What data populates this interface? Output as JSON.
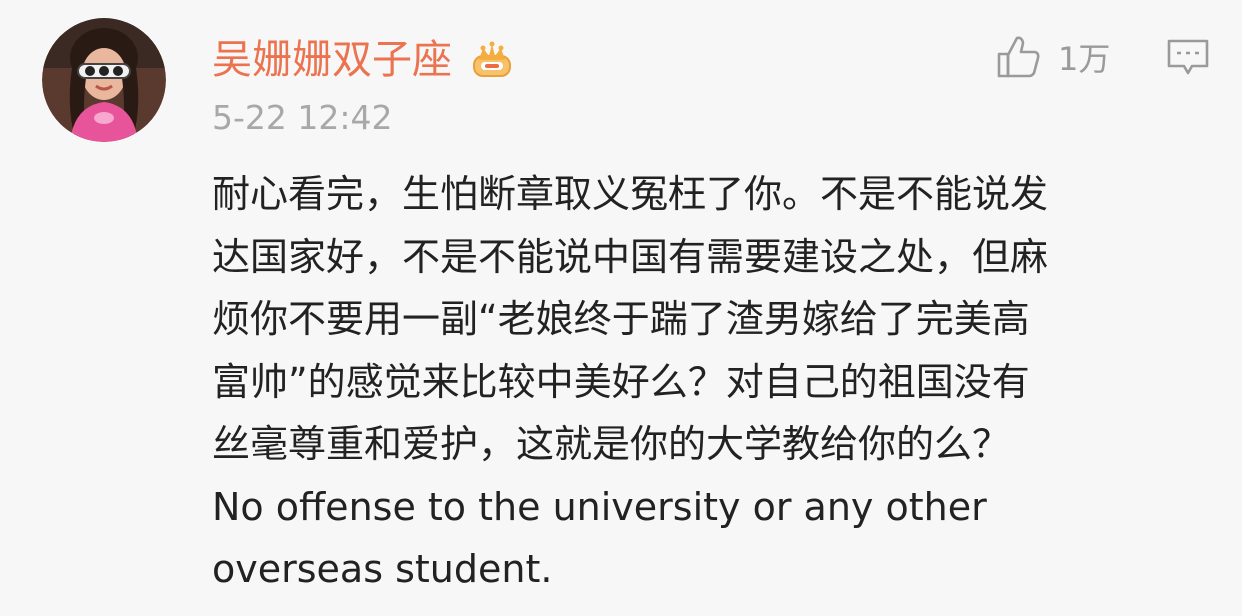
{
  "comment": {
    "author": {
      "name": "吴姗姗双子座",
      "avatar_icon": "user-avatar-photo",
      "badge_icon": "crown-vip-icon"
    },
    "timestamp": "5-22 12:42",
    "likes": {
      "icon": "thumbs-up-icon",
      "count": "1万"
    },
    "reply_icon": "comment-bubble-icon",
    "text_lines": [
      "耐心看完，生怕断章取义冤枉了你。不是不能说发",
      "达国家好，不是不能说中国有需要建设之处，但麻",
      "烦你不要用一副“老娘终于踹了渣男嫁给了完美高",
      "富帅”的感觉来比较中美好么？对自己的祖国没有",
      "丝毫尊重和爱护，这就是你的大学教给你的么？",
      "No offense to the university or any other",
      "overseas student."
    ],
    "colors": {
      "username": "#eb7350",
      "timestamp": "#a8a8a8",
      "text": "#222222",
      "icons": "#9a9a9a",
      "background": "#f7f7f7"
    }
  }
}
